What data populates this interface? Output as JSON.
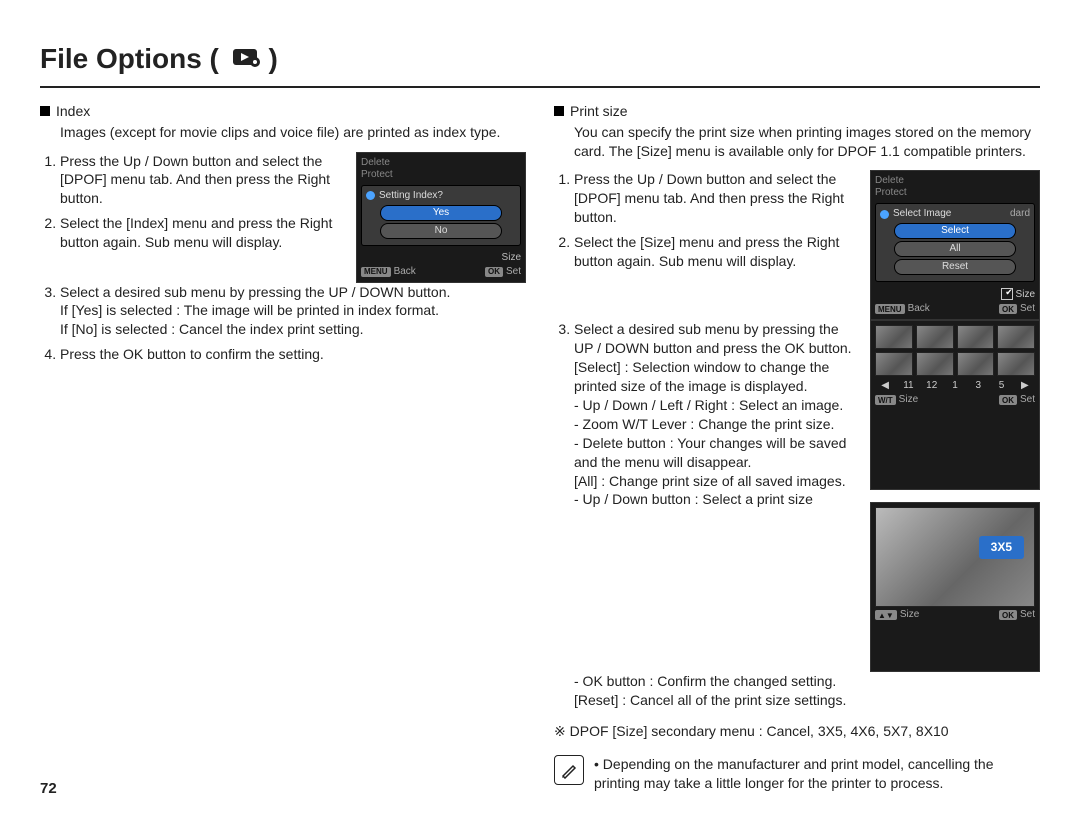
{
  "page_number": "72",
  "title": "File Options (",
  "title_close": ")",
  "icon_name": "playback-settings-icon",
  "left": {
    "heading": "Index",
    "intro": "Images (except for movie clips and voice file) are printed as index type.",
    "step1": "Press the Up / Down button and select the [DPOF] menu tab. And then press the Right button.",
    "step2": "Select the [Index] menu and press the Right button again. Sub menu will display.",
    "step3": "Select a desired sub menu by pressing the UP / DOWN button.",
    "yes_line": "If [Yes] is selected : The image will be printed in index format.",
    "no_line": "If [No] is selected   : Cancel the index print setting.",
    "step4": "Press the OK button to confirm the setting.",
    "shot": {
      "item1": "Delete",
      "item2": "Protect",
      "dialog_title": "Setting Index?",
      "opt_yes": "Yes",
      "opt_no": "No",
      "side_label": "Size",
      "back": "Back",
      "set": "Set",
      "menu": "MENU",
      "ok": "OK"
    }
  },
  "right": {
    "heading": "Print size",
    "intro": "You can specify the print size when printing images stored on the memory card. The [Size] menu is available only for DPOF 1.1 compatible printers.",
    "step1": "Press the Up / Down button and select the [DPOF] menu tab. And then press the Right button.",
    "step2": "Select the [Size] menu and press the Right button again. Sub menu will display.",
    "step3": "Select a desired sub menu by pressing the UP / DOWN button and press the OK button.",
    "select_line": "[Select] : Selection window to change the printed size of the image is displayed.",
    "select_sub1": "- Up / Down / Left / Right : Select an image.",
    "select_sub2": "- Zoom W/T Lever : Change the print size.",
    "select_sub3": "- Delete button : Your changes will be saved and the menu will disappear.",
    "all_line": "[All] : Change print size of all saved images.",
    "all_sub1": "- Up / Down button : Select a print size",
    "all_sub2": "- OK button : Confirm the changed setting.",
    "reset_line": "[Reset] : Cancel all of the print size settings.",
    "footnote": "※ DPOF [Size] secondary menu : Cancel, 3X5, 4X6, 5X7, 8X10",
    "shot1": {
      "item1": "Delete",
      "item2": "Protect",
      "dialog_title": "Select Image",
      "opt1": "Select",
      "opt2": "All",
      "opt3": "Reset",
      "side_size": "Size",
      "side_std": "dard",
      "back": "Back",
      "set": "Set",
      "menu": "MENU",
      "ok": "OK"
    },
    "shot2": {
      "n1": "11",
      "n2": "12",
      "n3": "1",
      "n4": "3",
      "n5": "5",
      "size": "Size",
      "set": "Set",
      "w": "W/T",
      "ok": "OK"
    },
    "shot3": {
      "tag": "3X5",
      "size": "Size",
      "set": "Set",
      "arrows": "▲▼",
      "ok": "OK"
    }
  },
  "note_text": "Depending on the manufacturer and print model, cancelling the printing may take a little longer for the printer to process."
}
